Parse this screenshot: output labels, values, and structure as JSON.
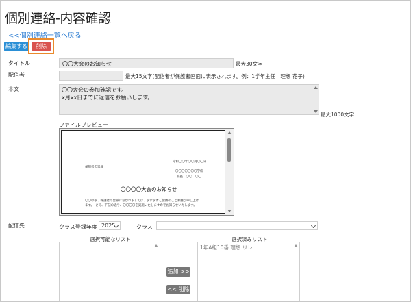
{
  "page": {
    "title": "個別連絡-内容確認",
    "back_link": "<<個別連絡一覧へ戻る"
  },
  "actions": {
    "edit_label": "編集する",
    "delete_label": "削除"
  },
  "form": {
    "title_label": "タイトル",
    "title_value": "〇〇大会のお知らせ",
    "title_note": "最大30文字",
    "sender_label": "配信者",
    "sender_value": "",
    "sender_note": "最大15文字(配信者が保護者画面に表示されます。例：1学年主任　理想 花子)",
    "body_label": "本文",
    "body_lines": [
      "〇〇大会の参加確認です。",
      "x月xx日までに返信をお願いします。"
    ],
    "body_note": "最大1000文字",
    "preview_label": "ファイルプレビュー"
  },
  "preview_doc": {
    "to": "保護者の皆様",
    "date": "令和〇〇年〇〇月〇〇日",
    "school": "〇〇〇〇〇〇〇学校",
    "principal": "校長　〇〇　〇〇",
    "heading": "〇〇〇〇大会のお知らせ",
    "body": "〇〇の候、保護者の皆様におかれましては、ますますご健勝のことお慶び申し上げます。　さて、下記の通り、〇〇〇〇を実施いたしますのでお知らせいたします。"
  },
  "recipients": {
    "label": "配信先",
    "year_label": "クラス登録年度",
    "year_value": "2025",
    "class_label": "クラス",
    "class_value": "",
    "available_title": "選択可能なリスト",
    "selected_title": "選択済みリスト",
    "selected_items": [
      "1年A組10番 理想 リレ"
    ],
    "add_label": "追加 >>",
    "remove_label": "<< 削除"
  }
}
